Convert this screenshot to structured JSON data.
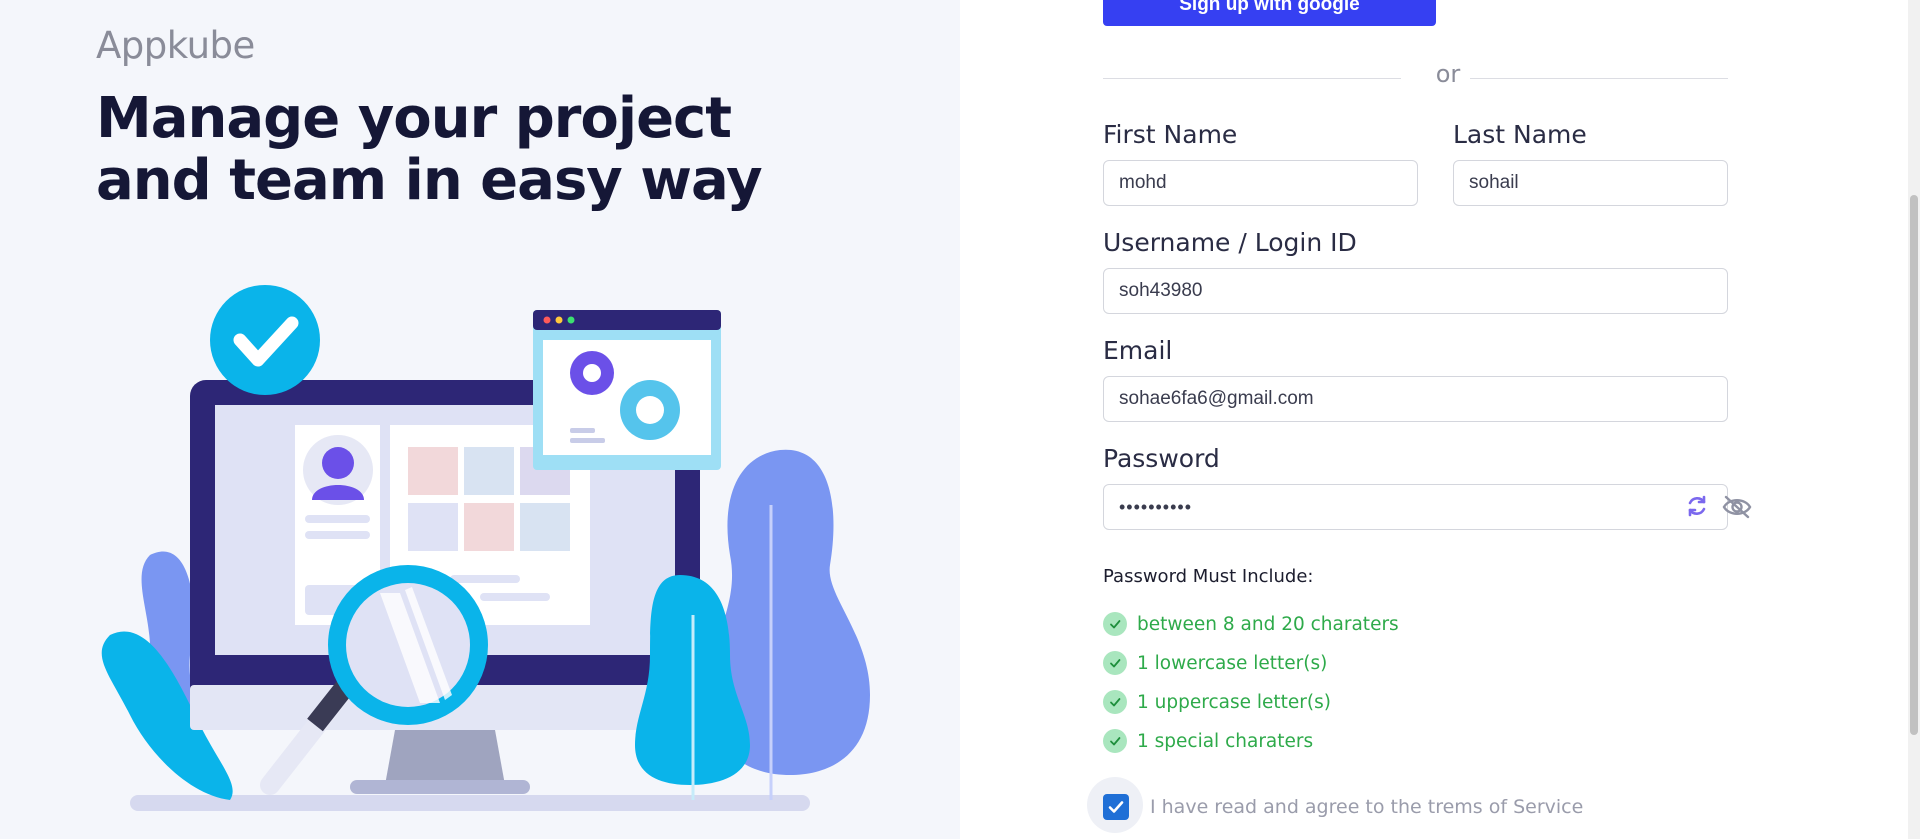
{
  "brand": "Appkube",
  "headline": "Manage your project and team in easy way",
  "google_button": "Sign up with google",
  "divider_text": "or",
  "fields": {
    "first_name": {
      "label": "First Name",
      "value": "mohd"
    },
    "last_name": {
      "label": "Last Name",
      "value": "sohail"
    },
    "username": {
      "label": "Username / Login ID",
      "value": "soh43980"
    },
    "email": {
      "label": "Email",
      "value": "sohae6fa6@gmail.com"
    },
    "password": {
      "label": "Password",
      "value": "••••••••••"
    }
  },
  "password_rules": {
    "title": "Password Must Include:",
    "items": [
      "between 8 and 20 charaters",
      "1 lowercase letter(s)",
      "1 uppercase letter(s)",
      "1 special charaters"
    ]
  },
  "agree_text": "I have read and agree to the trems of Service",
  "icons": {
    "refresh": "refresh-icon",
    "eye_off": "eye-off-icon",
    "check": "check-icon"
  },
  "colors": {
    "primary": "#3640f2",
    "success": "#2eaa4a",
    "heading": "#151736",
    "checkbox": "#1f6fd6"
  }
}
